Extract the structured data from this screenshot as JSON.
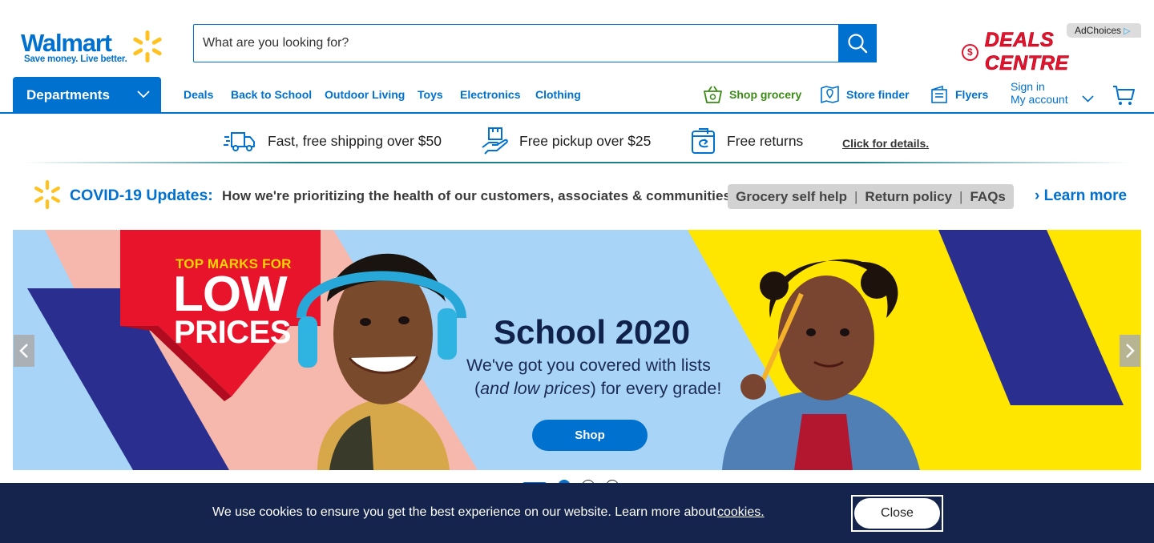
{
  "header": {
    "logo_word": "Walmart",
    "logo_tagline": "Save money. Live better.",
    "search_placeholder": "What are you looking for?",
    "adchoices_label": "AdChoices",
    "deals_centre_label": "DEALS CENTRE"
  },
  "nav": {
    "departments_label": "Departments",
    "links": [
      "Deals",
      "Back to School",
      "Outdoor Living",
      "Toys",
      "Electronics",
      "Clothing"
    ],
    "shop_grocery": "Shop grocery",
    "store_finder": "Store finder",
    "flyers": "Flyers",
    "sign_in": "Sign in",
    "my_account": "My account"
  },
  "value_props": {
    "shipping": "Fast, free shipping over $50",
    "pickup": "Free pickup over $25",
    "returns": "Free returns",
    "details_link": "Click for details."
  },
  "covid": {
    "title": "COVID-19 Updates:",
    "message": "How we're prioritizing the health of our customers, associates & communities.",
    "pills": [
      "Grocery self help",
      "Return policy",
      "FAQs"
    ],
    "learn_more": "Learn more"
  },
  "hero": {
    "top_marks": "TOP MARKS FOR",
    "low": "LOW",
    "prices": "PRICES",
    "title": "School 2020",
    "subtitle_line1": "We've got you covered with lists",
    "subtitle_line2_italic": "and low prices",
    "subtitle_line2_rest": "for every grade!",
    "cta": "Shop",
    "slide_count": 4,
    "active_slide": 1
  },
  "cookie": {
    "message": "We use cookies to ensure you get the best experience on our website. Learn more about",
    "link": "cookies.",
    "close_label": "Close"
  },
  "colors": {
    "brand_blue": "#0071ce",
    "spark_yellow": "#ffc220",
    "grocery_green": "#3b8b16",
    "deals_red": "#e3142d",
    "cookie_navy": "#14244c"
  }
}
